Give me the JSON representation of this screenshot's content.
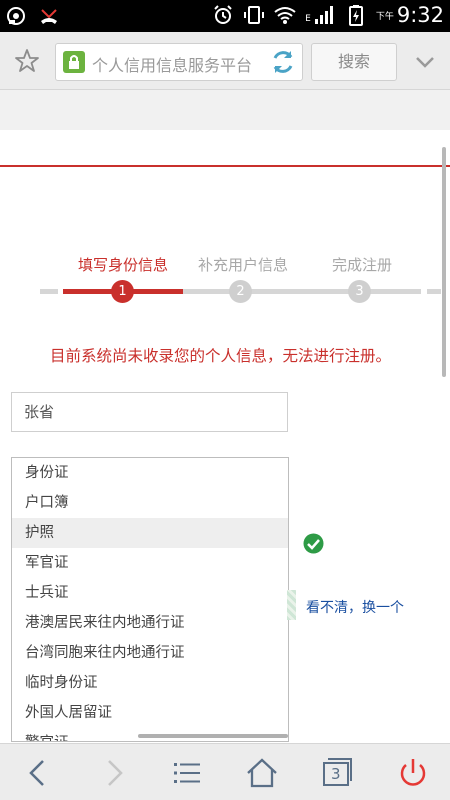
{
  "status_bar": {
    "time": "9:32",
    "ampm": "下午",
    "network_label": "E"
  },
  "browser": {
    "url_text": "个人信用信息服务平台",
    "search_label": "搜索"
  },
  "steps": [
    {
      "label": "填写身份信息",
      "number": "1",
      "state": "active"
    },
    {
      "label": "补充用户信息",
      "number": "2",
      "state": "inactive"
    },
    {
      "label": "完成注册",
      "number": "3",
      "state": "inactive"
    }
  ],
  "form": {
    "warning": "目前系统尚未收录您的个人信息，无法进行注册。",
    "name_value": "张省",
    "id_type_options": [
      "身份证",
      "户口簿",
      "护照",
      "军官证",
      "士兵证",
      "港澳居民来往内地通行证",
      "台湾同胞来往内地通行证",
      "临时身份证",
      "外国人居留证",
      "警官证"
    ],
    "selected_option": "护照",
    "captcha_refresh": "看不清，换一个"
  },
  "colors": {
    "accent_red": "#c9302c",
    "link_blue": "#1a4fa0",
    "valid_green": "#2e9b46"
  },
  "nav_icons": [
    "back-icon",
    "forward-icon",
    "menu-icon",
    "home-icon",
    "tabs-icon",
    "power-icon"
  ],
  "tabs_count": "3"
}
